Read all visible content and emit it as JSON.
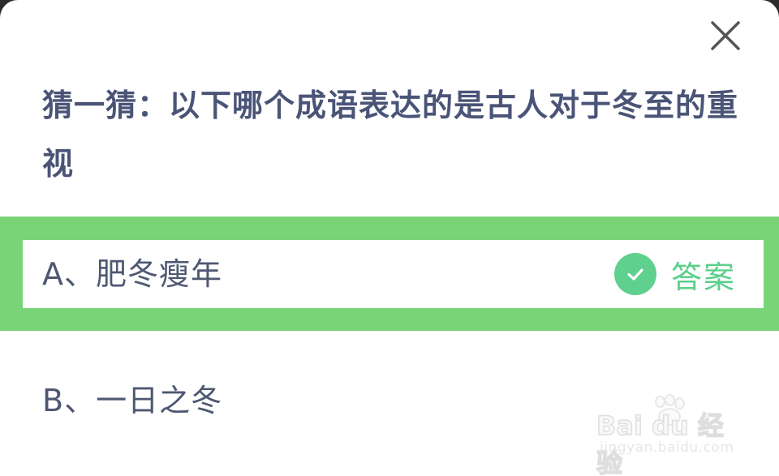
{
  "dialog": {
    "question": "猜一猜：以下哪个成语表达的是古人对于冬至的重视",
    "options": [
      {
        "label": "A、肥冬瘦年",
        "selected": true,
        "is_answer": true
      },
      {
        "label": "B、一日之冬",
        "selected": false,
        "is_answer": false
      }
    ],
    "answer_badge": "答案",
    "close_icon": "close-icon",
    "check_icon": "check-icon"
  },
  "watermark": {
    "brand": "Bai du 经验",
    "url": "jingyan.baidu.com"
  },
  "colors": {
    "question_text": "#4a5477",
    "option_text": "#4e5872",
    "selected_highlight": "#79d478",
    "answer_green": "#5fd08d",
    "close_icon": "#555555"
  }
}
